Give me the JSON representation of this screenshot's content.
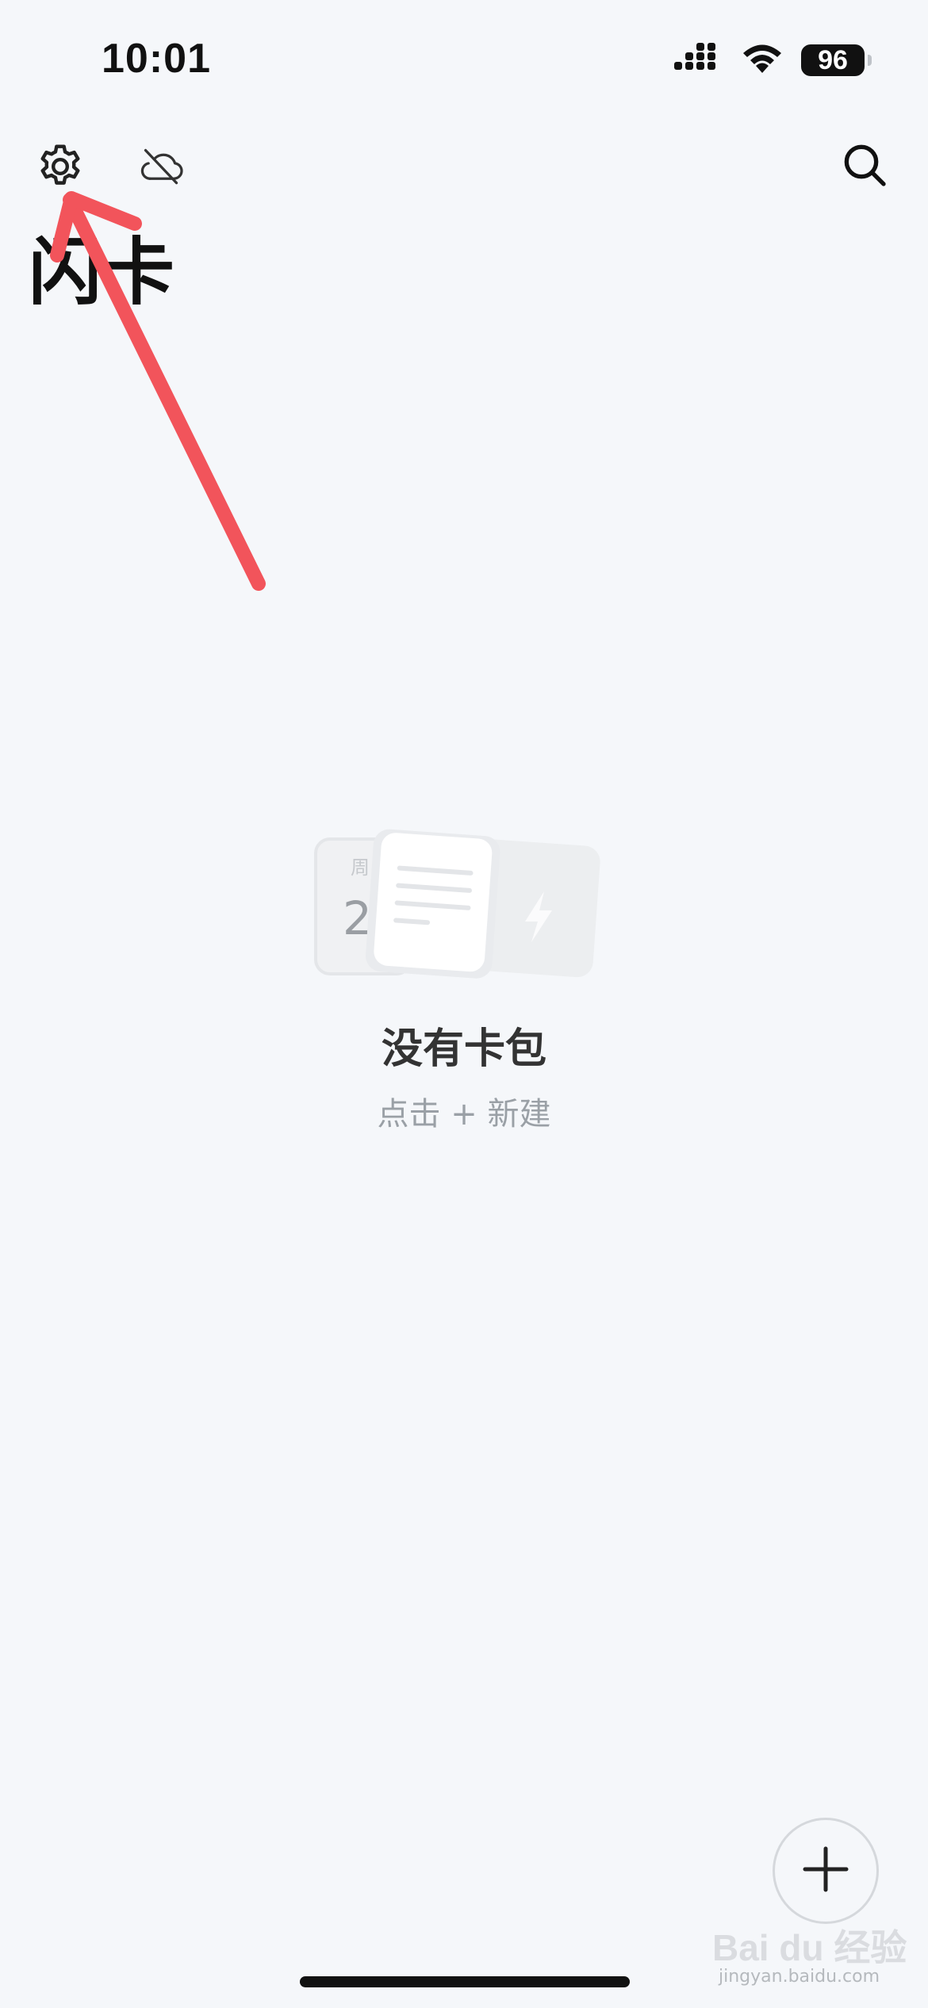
{
  "status_bar": {
    "time": "10:01",
    "battery": "96",
    "icons": [
      "signal-icon",
      "wifi-icon",
      "battery-icon"
    ]
  },
  "toolbar": {
    "icons": [
      "gear-icon",
      "cloud-off-icon",
      "search-icon"
    ]
  },
  "page": {
    "title": "闪卡"
  },
  "empty_state": {
    "title": "没有卡包",
    "hint": "点击 + 新建",
    "illustration_glyphs": [
      "周",
      "2"
    ]
  },
  "fab": {
    "icon": "plus-icon"
  },
  "annotation": {
    "color": "#f2545b",
    "icon": "arrow-icon"
  },
  "watermark": {
    "text": "Bai du 经验",
    "subtext": "jingyan.baidu.com"
  }
}
